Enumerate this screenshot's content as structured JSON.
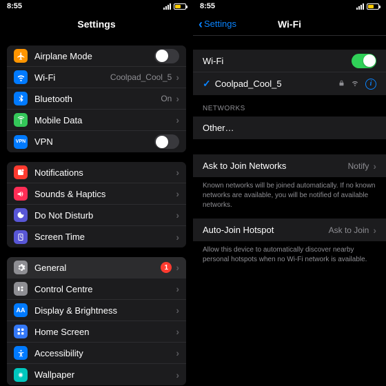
{
  "status": {
    "time": "8:55"
  },
  "left": {
    "title": "Settings",
    "sections": {
      "connectivity": [
        {
          "key": "airplane",
          "label": "Airplane Mode",
          "type": "toggle",
          "value": false,
          "icon": "airplane-icon",
          "color": "#ff9500"
        },
        {
          "key": "wifi",
          "label": "Wi-Fi",
          "type": "detail",
          "value": "Coolpad_Cool_5",
          "icon": "wifi-icon",
          "color": "#007aff"
        },
        {
          "key": "bluetooth",
          "label": "Bluetooth",
          "type": "detail",
          "value": "On",
          "icon": "bluetooth-icon",
          "color": "#007aff"
        },
        {
          "key": "mobile",
          "label": "Mobile Data",
          "type": "nav",
          "icon": "antenna-icon",
          "color": "#34c759"
        },
        {
          "key": "vpn",
          "label": "VPN",
          "type": "toggle",
          "value": false,
          "icon": "vpn-icon",
          "color": "#007aff"
        }
      ],
      "alerts": [
        {
          "key": "notifications",
          "label": "Notifications",
          "type": "nav",
          "icon": "notifications-icon",
          "color": "#ff3b30"
        },
        {
          "key": "sounds",
          "label": "Sounds & Haptics",
          "type": "nav",
          "icon": "sounds-icon",
          "color": "#ff2d55"
        },
        {
          "key": "dnd",
          "label": "Do Not Disturb",
          "type": "nav",
          "icon": "moon-icon",
          "color": "#5856d6"
        },
        {
          "key": "screentime",
          "label": "Screen Time",
          "type": "nav",
          "icon": "screentime-icon",
          "color": "#5856d6"
        }
      ],
      "general": [
        {
          "key": "general",
          "label": "General",
          "type": "nav",
          "badge": "1",
          "icon": "gear-icon",
          "color": "#8e8e93"
        },
        {
          "key": "control",
          "label": "Control Centre",
          "type": "nav",
          "icon": "control-icon",
          "color": "#8e8e93"
        },
        {
          "key": "display",
          "label": "Display & Brightness",
          "type": "nav",
          "icon": "display-icon",
          "color": "#007aff"
        },
        {
          "key": "home",
          "label": "Home Screen",
          "type": "nav",
          "icon": "home-icon",
          "color": "#3478f6"
        },
        {
          "key": "accessibility",
          "label": "Accessibility",
          "type": "nav",
          "icon": "accessibility-icon",
          "color": "#007aff"
        },
        {
          "key": "wallpaper",
          "label": "Wallpaper",
          "type": "nav",
          "icon": "wallpaper-icon",
          "color": "#00c7be"
        }
      ]
    }
  },
  "right": {
    "back": "Settings",
    "title": "Wi-Fi",
    "wifi_label": "Wi-Fi",
    "wifi_on": true,
    "current_network": "Coolpad_Cool_5",
    "networks_header": "NETWORKS",
    "other_label": "Other…",
    "ask_join_label": "Ask to Join Networks",
    "ask_join_value": "Notify",
    "ask_join_footer": "Known networks will be joined automatically. If no known networks are available, you will be notified of available networks.",
    "auto_hotspot_label": "Auto-Join Hotspot",
    "auto_hotspot_value": "Ask to Join",
    "auto_hotspot_footer": "Allow this device to automatically discover nearby personal hotspots when no Wi-Fi network is available."
  }
}
